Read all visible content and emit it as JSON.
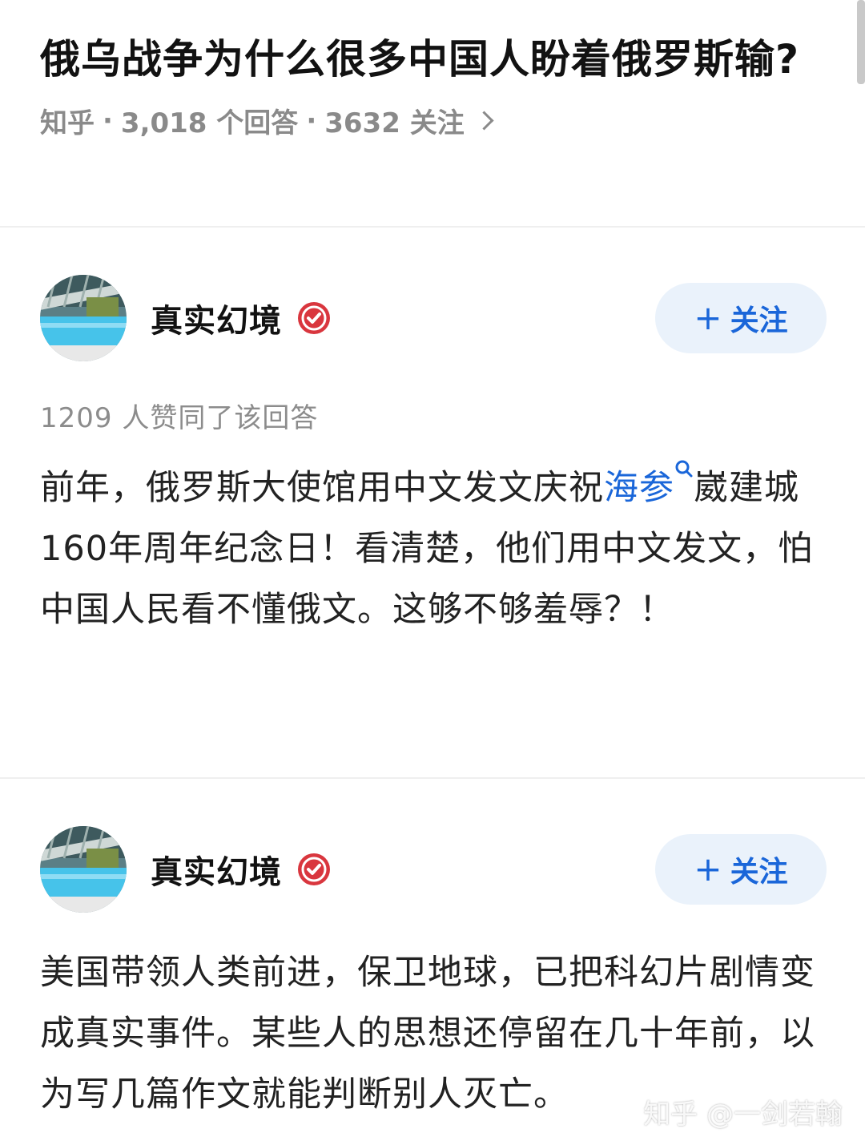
{
  "question": {
    "title": "俄乌战争为什么很多中国人盼着俄罗斯输?",
    "source": "知乎",
    "answers_count": "3,018 个回答",
    "followers": "3632 关注",
    "separator": "·"
  },
  "answers": [
    {
      "author": "真实幻境",
      "follow_label": "关注",
      "votes": "1209 人赞同了该回答",
      "text_before_link": "前年，俄罗斯大使馆用中文发文庆祝",
      "link_text": "海参",
      "text_after_link": "崴建城160年周年纪念日！看清楚，他们用中文发文，怕中国人民看不懂俄文。这够不够羞辱？！"
    },
    {
      "author": "真实幻境",
      "follow_label": "关注",
      "text": "美国带领人类前进，保卫地球，已把科幻片剧情变成真实事件。某些人的思想还停留在几十年前，以为写几篇作文就能判断别人灭亡。"
    }
  ],
  "watermark": "知乎 @一剑若翰",
  "colors": {
    "accent": "#1a66d9",
    "follow_bg": "#eaf2fb",
    "meta_gray": "#8a8a8a",
    "verified_red": "#d9363e"
  },
  "icons": {
    "chevron": "chevron-right-icon",
    "verified": "verified-badge-icon",
    "plus": "plus-icon",
    "search": "search-icon"
  }
}
